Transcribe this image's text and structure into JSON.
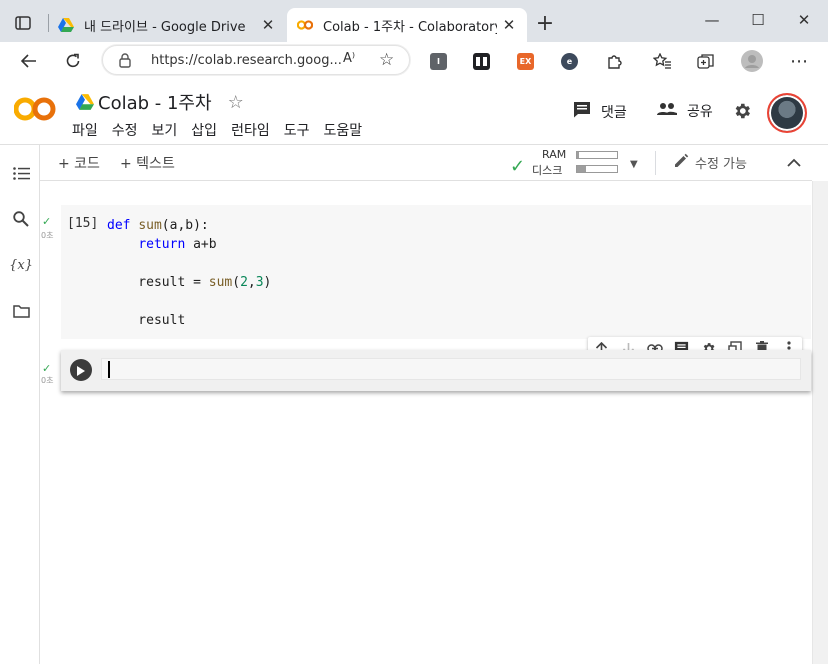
{
  "browser": {
    "tabs": [
      {
        "title": "내 드라이브 - Google Drive",
        "icon": "google-drive-icon",
        "active": false
      },
      {
        "title": "Colab - 1주차 - Colaboratory",
        "icon": "colab-icon",
        "active": true
      }
    ],
    "new_tab_label": "+",
    "window_controls": {
      "minimize": "—",
      "maximize": "☐",
      "close": "✕"
    },
    "address_url": "https://colab.research.goog...",
    "read_aloud_label": "A⁾",
    "extensions": [
      {
        "label": "I",
        "color": "#5f6368"
      },
      {
        "label": "▮▮",
        "color": "#202124"
      },
      {
        "label": "EX",
        "color": "#e8672a"
      },
      {
        "label": "e",
        "color": "#3d4a5c"
      }
    ]
  },
  "colab": {
    "notebook_title": "Colab - 1주차",
    "menu": [
      "파일",
      "수정",
      "보기",
      "삽입",
      "런타임",
      "도구",
      "도움말"
    ],
    "comment_label": "댓글",
    "share_label": "공유",
    "add_code_label": "+ 코드",
    "add_text_label": "+ 텍스트",
    "ram_label": "RAM",
    "disk_label": "디스크",
    "ram_usage": 0.05,
    "disk_usage": 0.22,
    "edit_mode_label": "수정 가능",
    "sidebar_icons": [
      "table-of-contents-icon",
      "search-icon",
      "variables-icon",
      "files-icon"
    ],
    "variables_glyph": "{x}"
  },
  "cells": [
    {
      "exec_count": "[15]",
      "exec_time": "0초",
      "status": "✓",
      "code_lines": [
        [
          {
            "t": "def ",
            "c": "kw"
          },
          {
            "t": "sum",
            "c": "fn"
          },
          {
            "t": "(a,b):",
            "c": ""
          }
        ],
        [
          {
            "t": "    ",
            "c": ""
          },
          {
            "t": "return",
            "c": "kw"
          },
          {
            "t": " a+b",
            "c": ""
          }
        ],
        [
          {
            "t": "",
            "c": ""
          }
        ],
        [
          {
            "t": "    result = ",
            "c": ""
          },
          {
            "t": "sum",
            "c": "fn"
          },
          {
            "t": "(",
            "c": ""
          },
          {
            "t": "2",
            "c": "num"
          },
          {
            "t": ",",
            "c": ""
          },
          {
            "t": "3",
            "c": "num"
          },
          {
            "t": ")",
            "c": ""
          }
        ],
        [
          {
            "t": "",
            "c": ""
          }
        ],
        [
          {
            "t": "    result",
            "c": ""
          }
        ]
      ]
    },
    {
      "exec_count": "",
      "exec_time": "0초",
      "status": "✓",
      "code_lines": []
    }
  ],
  "cell_toolbar": [
    "move-up-icon",
    "move-down-icon",
    "link-icon",
    "comment-icon",
    "settings-icon",
    "mirror-cell-icon",
    "delete-icon",
    "more-vert-icon"
  ]
}
